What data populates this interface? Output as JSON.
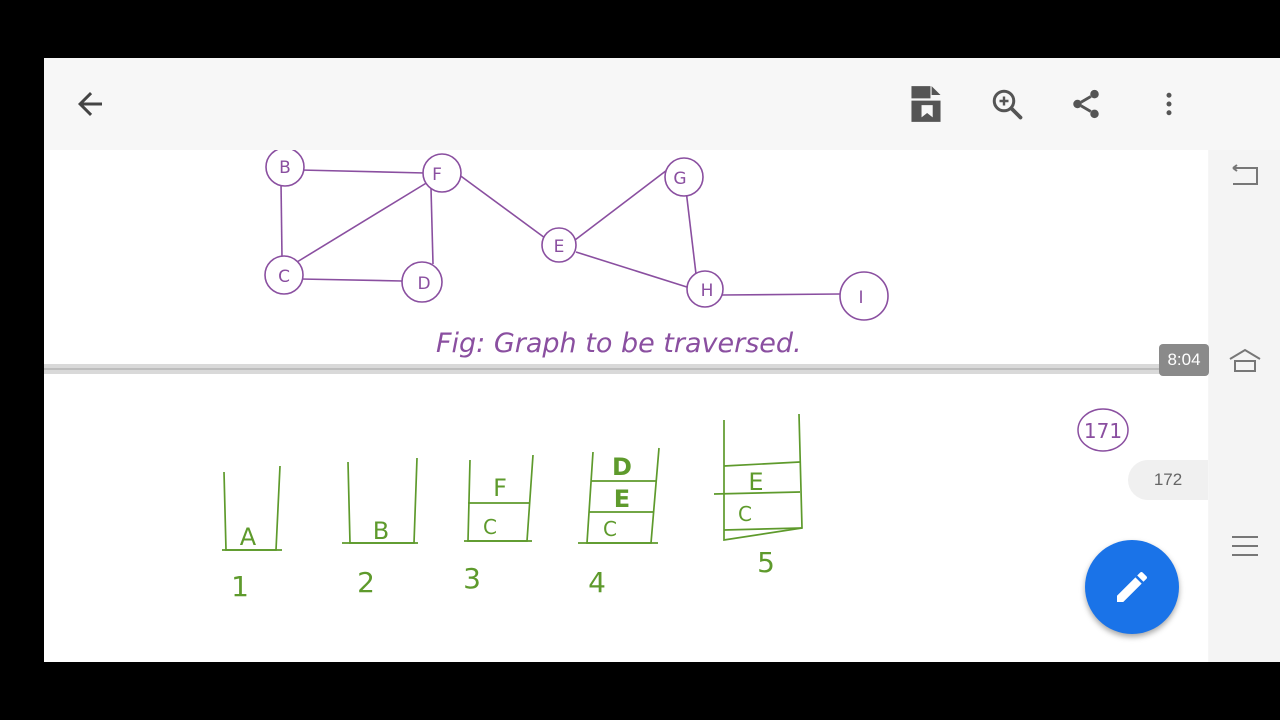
{
  "graph": {
    "nodes": [
      "B",
      "F",
      "G",
      "C",
      "D",
      "E",
      "H",
      "I"
    ],
    "caption": "Fig: Graph to be traversed."
  },
  "page_171": {
    "number_label": "171"
  },
  "stacks": [
    {
      "label": "1",
      "cells": [
        "A"
      ]
    },
    {
      "label": "2",
      "cells": [
        "B"
      ]
    },
    {
      "label": "3",
      "cells": [
        "C",
        "F"
      ]
    },
    {
      "label": "4",
      "cells": [
        "C",
        "E",
        "D"
      ]
    },
    {
      "label": "5",
      "cells": [
        "C",
        "E"
      ]
    }
  ],
  "overlay": {
    "time": "8:04",
    "page_indicator": "172"
  },
  "icons": {
    "back": "arrow-left-icon",
    "bookmark": "bookmark-icon",
    "search": "search-icon",
    "share": "share-icon",
    "more": "more-vert-icon",
    "edit": "pencil-icon",
    "nav_back": "nav-back-icon",
    "nav_home": "nav-home-icon",
    "nav_menu": "nav-menu-icon"
  },
  "colors": {
    "ink_purple": "#8a4fa0",
    "ink_green": "#5e9a2c",
    "fab_blue": "#1a73e8"
  }
}
